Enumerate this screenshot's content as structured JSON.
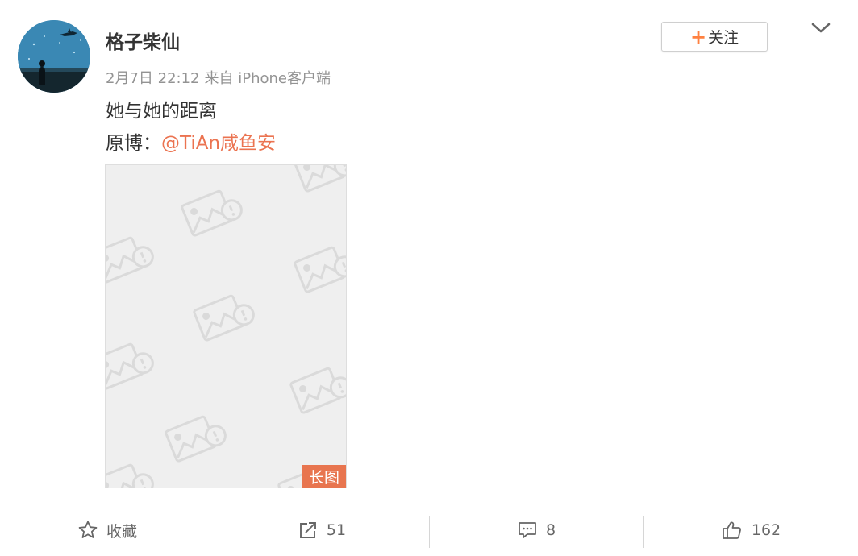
{
  "post": {
    "author": "格子柴仙",
    "date": "2月7日 22:12",
    "source": "来自 iPhone客户端",
    "text": "她与她的距离",
    "repost_prefix": "原博：",
    "repost_mention": "@TiAn咸鱼安",
    "image_badge": "长图"
  },
  "follow": {
    "plus": "+",
    "label": "关注"
  },
  "actions": {
    "favorite_label": "收藏",
    "repost_count": "51",
    "comment_count": "8",
    "like_count": "162"
  },
  "colors": {
    "accent": "#eb7350",
    "badge": "#e8754f",
    "meta": "#939393"
  },
  "icons": [
    "chevron-down-icon",
    "star-icon",
    "share-icon",
    "comment-icon",
    "thumbs-up-icon",
    "image-placeholder-icon"
  ]
}
